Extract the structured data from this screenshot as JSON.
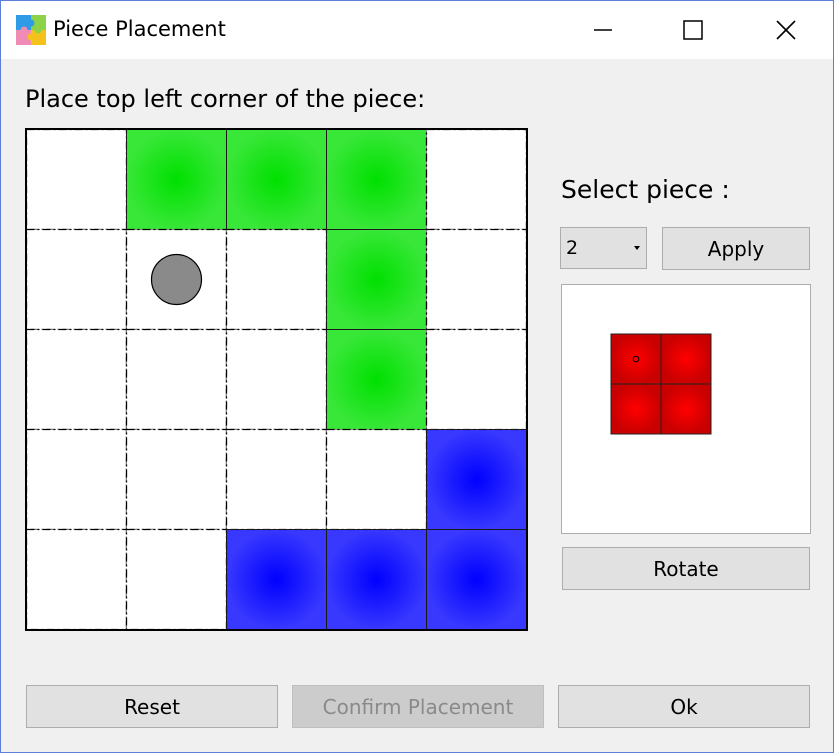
{
  "window": {
    "title": "Piece Placement",
    "app_icon": "puzzle-icon",
    "border_color": "#5b7fd6"
  },
  "prompt": "Place top left corner of the piece:",
  "board": {
    "rows": 5,
    "cols": 5,
    "cells": [
      [
        "empty",
        "green",
        "green",
        "green",
        "empty"
      ],
      [
        "empty",
        "empty",
        "empty",
        "green",
        "empty"
      ],
      [
        "empty",
        "empty",
        "empty",
        "green",
        "empty"
      ],
      [
        "empty",
        "empty",
        "empty",
        "empty",
        "blue"
      ],
      [
        "empty",
        "empty",
        "blue",
        "blue",
        "blue"
      ]
    ],
    "marker": {
      "row": 1,
      "col": 1,
      "color": "#8a8a8a"
    },
    "colors": {
      "green": "#00e000",
      "blue": "#0000ff",
      "empty": "#ffffff"
    }
  },
  "side_panel": {
    "select_label": "Select piece :",
    "piece_select": {
      "value": "2",
      "icon": "dropdown-arrow-icon"
    },
    "apply_label": "Apply",
    "preview": {
      "rows": 2,
      "cols": 2,
      "cells": [
        [
          "red",
          "red"
        ],
        [
          "red",
          "red"
        ]
      ],
      "anchor": {
        "row": 0,
        "col": 0
      },
      "colors": {
        "red": "#ff0000"
      }
    },
    "rotate_label": "Rotate"
  },
  "footer": {
    "reset_label": "Reset",
    "confirm_label": "Confirm Placement",
    "confirm_enabled": false,
    "ok_label": "Ok"
  }
}
